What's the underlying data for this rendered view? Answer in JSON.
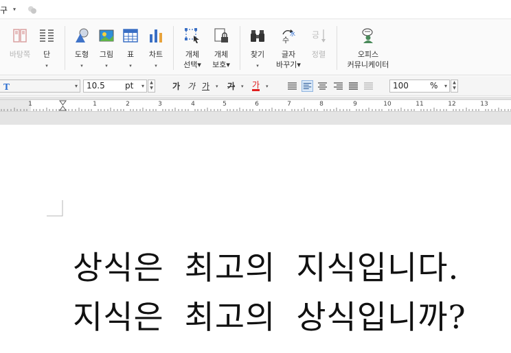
{
  "menu": {
    "item": "구",
    "arrow": "▾"
  },
  "ribbon": {
    "buttons": [
      {
        "label": "바탕쪽",
        "dropdown": "",
        "disabled": true
      },
      {
        "label": "단",
        "dropdown": "▾",
        "disabled": false
      },
      {
        "label": "도형",
        "dropdown": "▾",
        "disabled": false
      },
      {
        "label": "그림",
        "dropdown": "▾",
        "disabled": false
      },
      {
        "label": "표",
        "dropdown": "▾",
        "disabled": false
      },
      {
        "label": "차트",
        "dropdown": "▾",
        "disabled": false
      },
      {
        "label": "개체\n선택▾",
        "dropdown": "",
        "disabled": false
      },
      {
        "label": "개체\n보호▾",
        "dropdown": "",
        "disabled": false
      },
      {
        "label": "찾기",
        "dropdown": "▾",
        "disabled": false
      },
      {
        "label": "글자\n바꾸기▾",
        "dropdown": "",
        "disabled": false
      },
      {
        "label": "정렬",
        "dropdown": "",
        "disabled": true
      },
      {
        "label": "오피스\n커뮤니케이터",
        "dropdown": "",
        "disabled": false
      }
    ],
    "text": {
      "b0": "바탕쪽",
      "b1": "단",
      "b2": "도형",
      "b3": "그림",
      "b4": "표",
      "b5": "차트",
      "b6a": "개체",
      "b6b": "선택▾",
      "b7a": "개체",
      "b7b": "보호▾",
      "b8": "찾기",
      "b9a": "글자",
      "b9b": "바꾸기▾",
      "b10": "정렬",
      "b11a": "오피스",
      "b11b": "커뮤니케이터",
      "dd": "▾",
      "replace_badge": "水"
    }
  },
  "format_bar": {
    "font_value": "",
    "font_size": "10.5",
    "size_unit": "pt",
    "bold": "가",
    "italic": "가",
    "underline": "가",
    "strike": "가",
    "color": "가",
    "zoom_value": "100",
    "zoom_unit": "%",
    "arrow": "▾"
  },
  "ruler": {
    "numbers": [
      "1",
      "1",
      "2",
      "3",
      "4",
      "5",
      "6",
      "7",
      "8",
      "9",
      "10",
      "11",
      "12",
      "13"
    ]
  },
  "document": {
    "line1": "상식은 최고의 지식입니다.",
    "line2": "지식은 최고의 상식입니까?"
  },
  "colors": {
    "accent": "#2e6fd1",
    "font_color_bar": "#e02020"
  }
}
